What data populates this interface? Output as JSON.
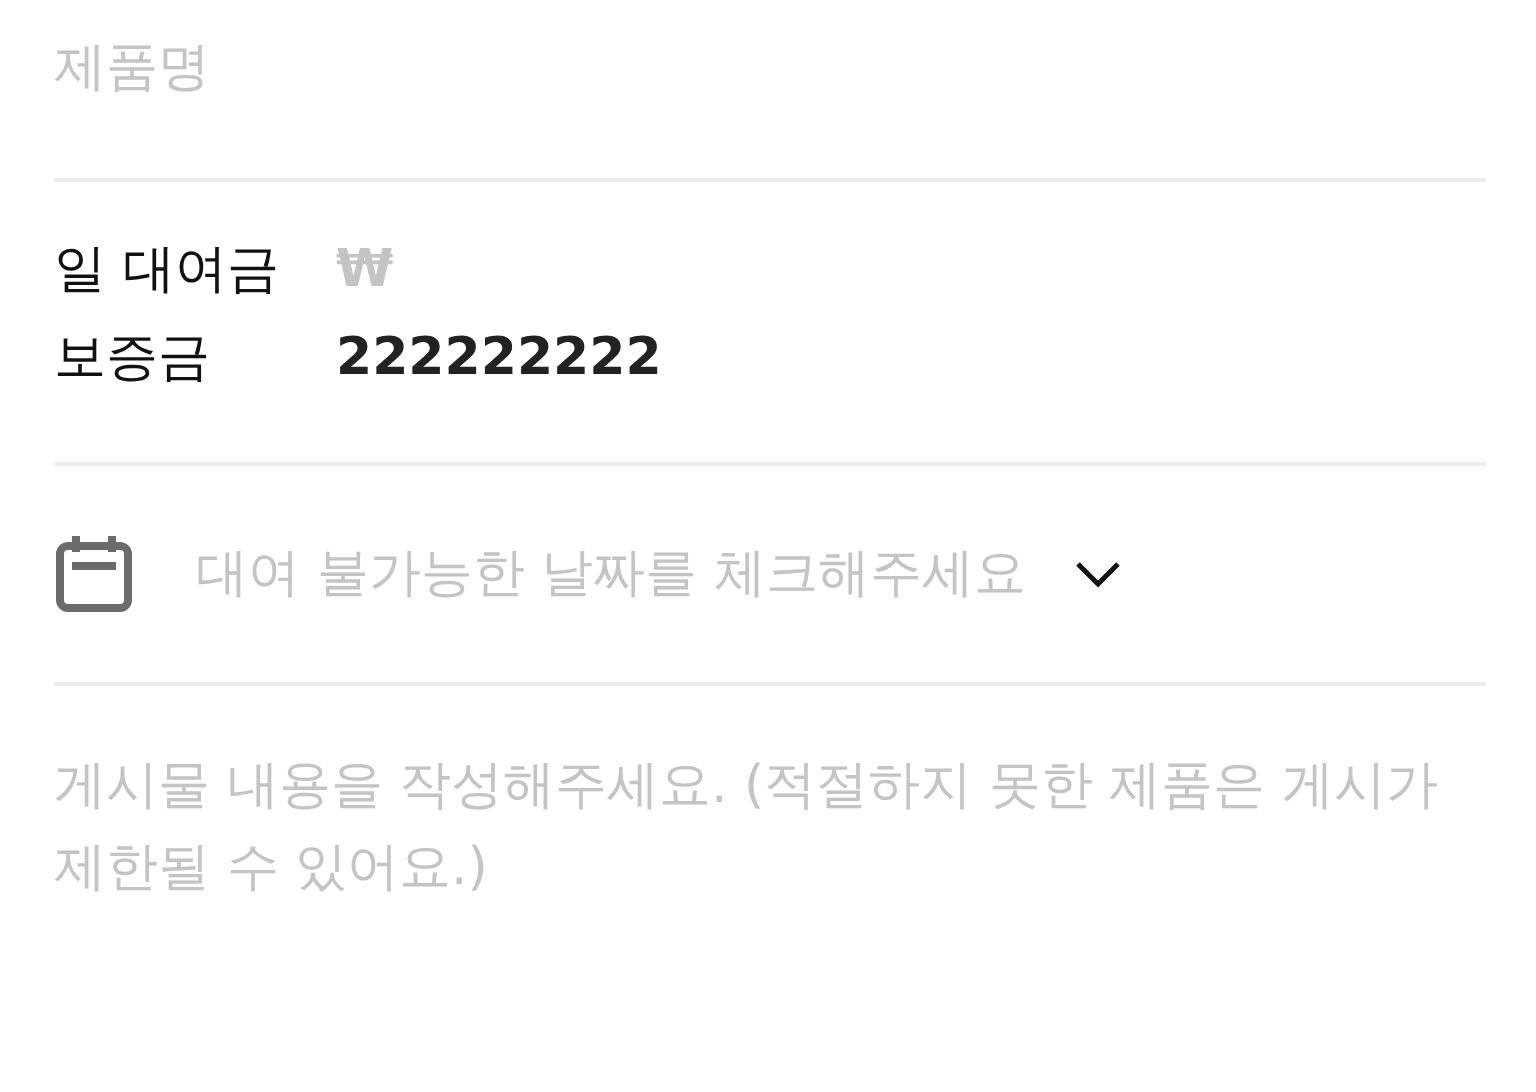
{
  "product_name": {
    "placeholder": "제품명"
  },
  "price_rows": [
    {
      "label": "일 대여금",
      "placeholder": "₩"
    },
    {
      "label": "보증금",
      "value": "222222222"
    }
  ],
  "date_select": {
    "placeholder": "대여 불가능한 날짜를 체크해주세요",
    "expanded": false
  },
  "description": {
    "placeholder": "게시물 내용을 작성해주세요. (적절하지 못한 제품은 게시가 제한될 수 있어요.)"
  }
}
